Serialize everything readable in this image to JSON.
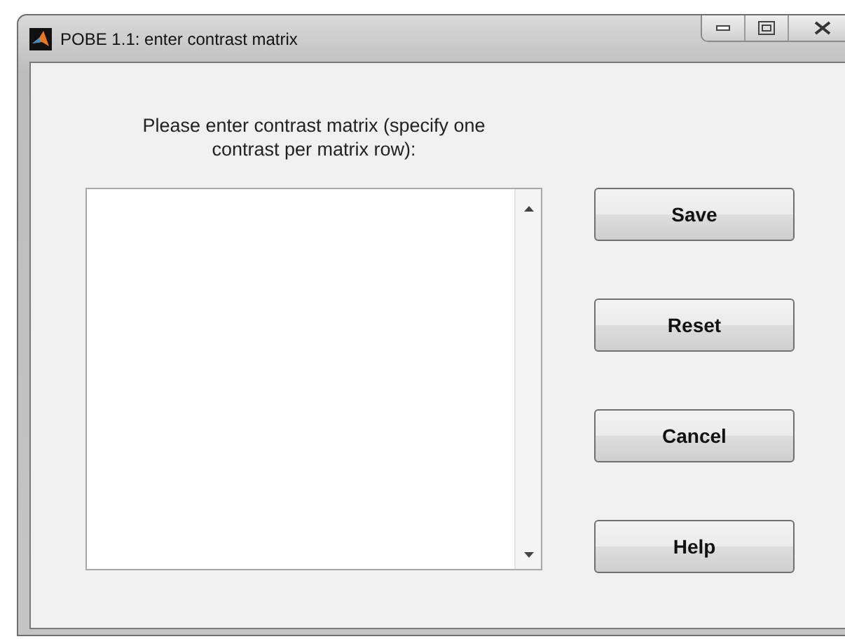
{
  "window": {
    "title": "POBE 1.1: enter contrast matrix"
  },
  "prompt": "Please enter contrast matrix (specify one contrast per matrix row):",
  "buttons": [
    "Save",
    "Reset",
    "Cancel",
    "Help"
  ]
}
